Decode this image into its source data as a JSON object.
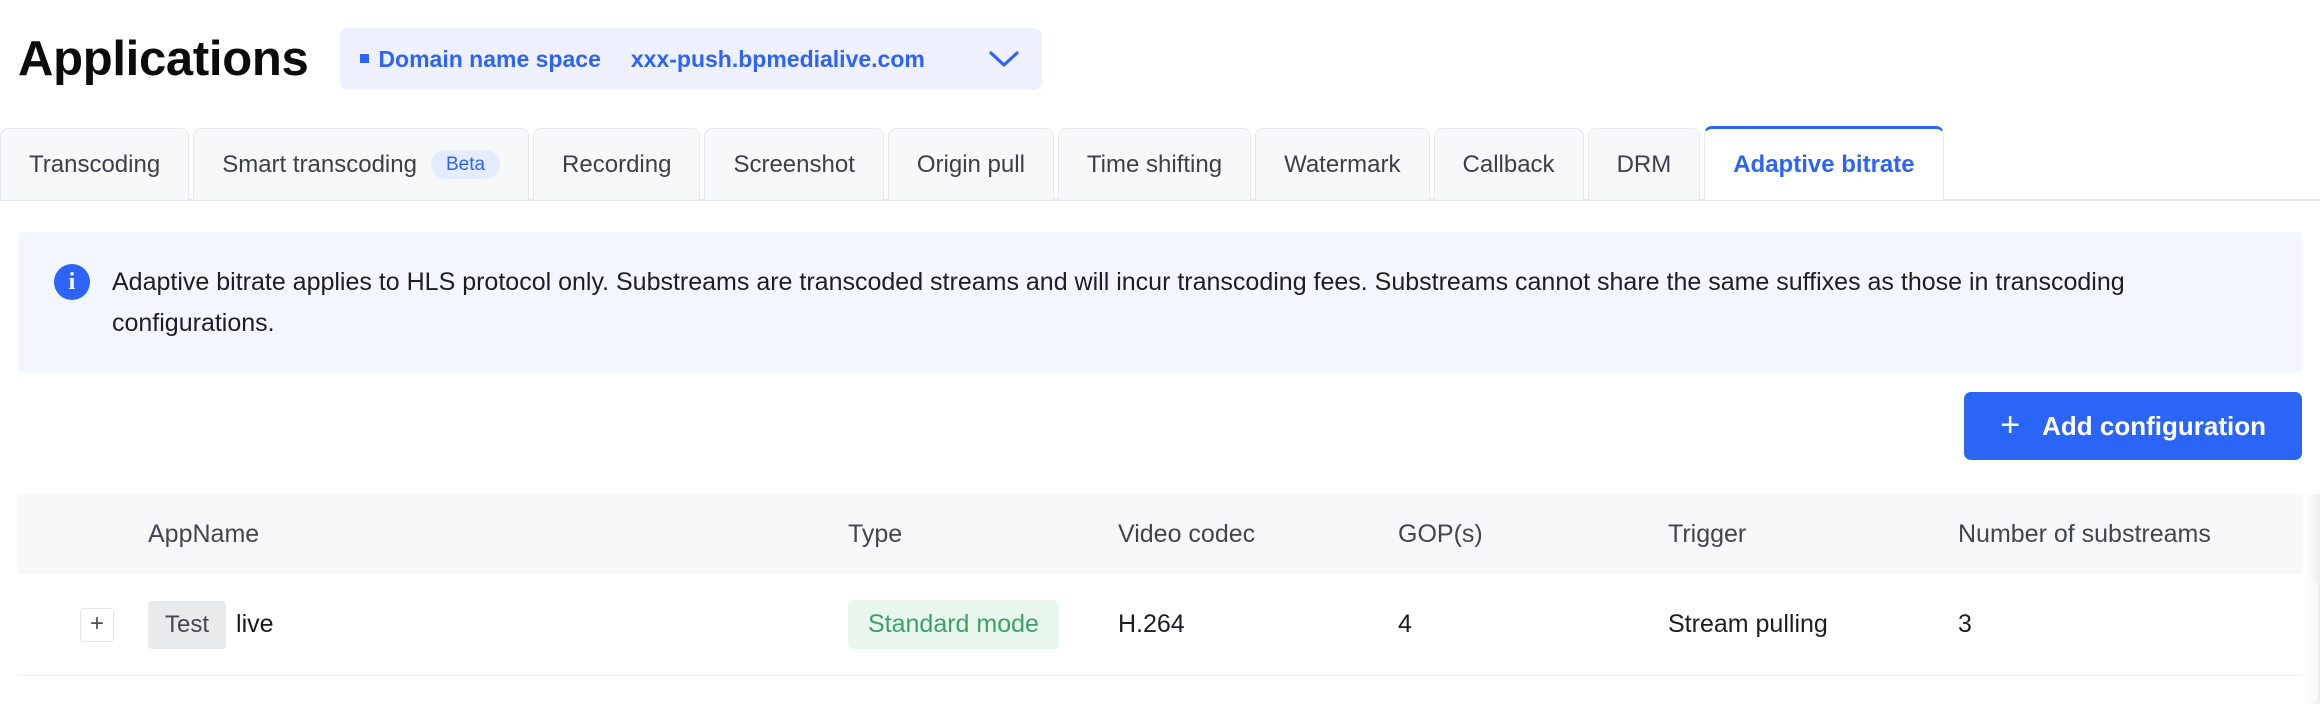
{
  "header": {
    "title": "Applications",
    "domain_selector": {
      "label": "Domain name space",
      "value": "xxx-push.bpmedialive.com",
      "caret_icon": "chevron-down-icon",
      "bullet_icon": "square-bullet-icon"
    }
  },
  "tabs": [
    {
      "label": "Transcoding",
      "badge": null,
      "active": false
    },
    {
      "label": "Smart transcoding",
      "badge": "Beta",
      "active": false
    },
    {
      "label": "Recording",
      "badge": null,
      "active": false
    },
    {
      "label": "Screenshot",
      "badge": null,
      "active": false
    },
    {
      "label": "Origin pull",
      "badge": null,
      "active": false
    },
    {
      "label": "Time shifting",
      "badge": null,
      "active": false
    },
    {
      "label": "Watermark",
      "badge": null,
      "active": false
    },
    {
      "label": "Callback",
      "badge": null,
      "active": false
    },
    {
      "label": "DRM",
      "badge": null,
      "active": false
    },
    {
      "label": "Adaptive bitrate",
      "badge": null,
      "active": true
    }
  ],
  "info_banner": {
    "icon": "info-circle-icon",
    "text": "Adaptive bitrate applies to HLS protocol only. Substreams are transcoded streams and will incur transcoding fees. Substreams cannot share the same suffixes as those in transcoding configurations."
  },
  "actions": {
    "add_configuration_label": "Add configuration",
    "add_icon": "plus-icon"
  },
  "table": {
    "columns": [
      "",
      "AppName",
      "Type",
      "Video codec",
      "GOP(s)",
      "Trigger",
      "Number of substreams"
    ],
    "rows": [
      {
        "expand_icon": "plus-icon",
        "app_tag": "Test",
        "app_name": "live",
        "type": "Standard mode",
        "video_codec": "H.264",
        "gop": "4",
        "trigger": "Stream pulling",
        "substreams": "3"
      }
    ]
  },
  "colors": {
    "accent": "#2d63f6",
    "accent_button": "#2b65f5",
    "info_bg": "#f3f6fe",
    "tab_bg": "#f7f8fa",
    "badge_green_text": "#3ba06a",
    "badge_green_bg": "#e8f6ee",
    "tag_gray_bg": "#e9eaec"
  }
}
